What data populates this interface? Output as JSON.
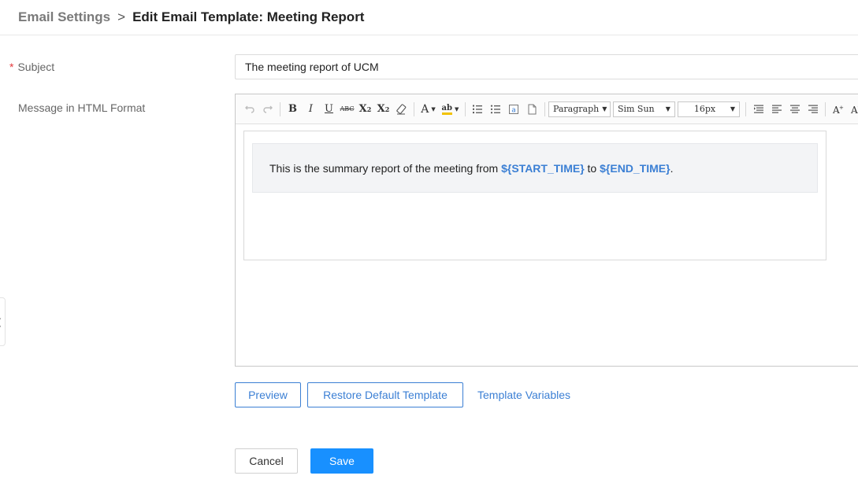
{
  "breadcrumb": {
    "parent": "Email Settings",
    "separator": ">",
    "current": "Edit Email Template: Meeting Report"
  },
  "form": {
    "subject_label": "Subject",
    "subject_required_mark": "*",
    "subject_value": "The meeting report of UCM",
    "message_label": "Message in HTML Format"
  },
  "editor": {
    "toolbar": {
      "undo_icon": "undo-icon",
      "redo_icon": "redo-icon",
      "bold": "B",
      "italic": "I",
      "underline": "U",
      "strikethrough": "ABC",
      "superscript": "X",
      "subscript": "X",
      "font_color": "A",
      "highlight": "ab",
      "paragraph_select": "Paragraph",
      "font_family_select": "Sim Sun",
      "font_size_select": "16px"
    },
    "content": {
      "text_before": "This is the summary report of the meeting from ",
      "var_start": "${START_TIME}",
      "text_middle": " to ",
      "var_end": "${END_TIME}",
      "text_after": "."
    }
  },
  "actions": {
    "preview": "Preview",
    "restore": "Restore Default Template",
    "variables": "Template Variables",
    "cancel": "Cancel",
    "save": "Save"
  },
  "side_tab": {
    "icon": "chevron-left-icon"
  },
  "colors": {
    "accent": "#3b7fd4",
    "primary_button": "#1890ff",
    "required": "#e4393c"
  }
}
